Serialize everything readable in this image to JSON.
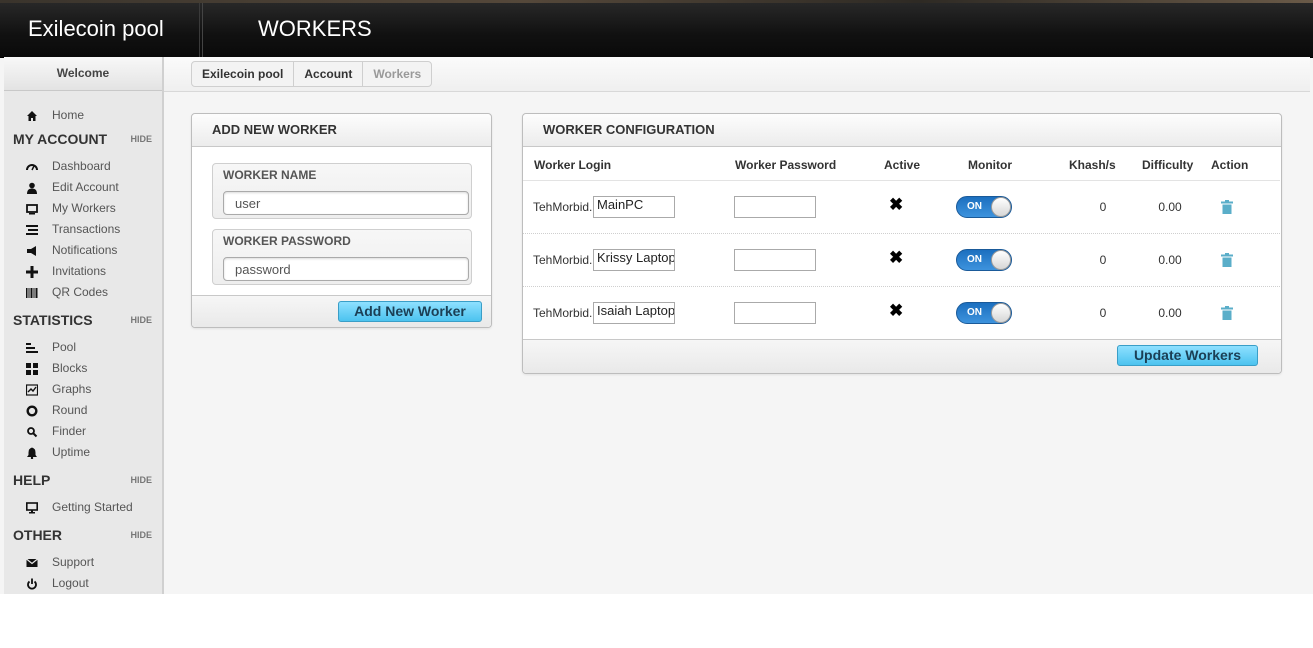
{
  "app": {
    "brand": "Exilecoin pool",
    "page_title": "WORKERS"
  },
  "sidebar": {
    "welcome": "Welcome",
    "home": {
      "label": "Home",
      "icon": "home-icon"
    },
    "sections": [
      {
        "title": "MY ACCOUNT",
        "hide": "HIDE",
        "items": [
          {
            "label": "Dashboard",
            "icon": "dashboard-icon"
          },
          {
            "label": "Edit Account",
            "icon": "user-icon"
          },
          {
            "label": "My Workers",
            "icon": "monitor-icon"
          },
          {
            "label": "Transactions",
            "icon": "list-icon"
          },
          {
            "label": "Notifications",
            "icon": "megaphone-icon"
          },
          {
            "label": "Invitations",
            "icon": "plus-icon"
          },
          {
            "label": "QR Codes",
            "icon": "barcode-icon"
          }
        ]
      },
      {
        "title": "STATISTICS",
        "hide": "HIDE",
        "items": [
          {
            "label": "Pool",
            "icon": "bars-icon"
          },
          {
            "label": "Blocks",
            "icon": "grid-icon"
          },
          {
            "label": "Graphs",
            "icon": "chart-icon"
          },
          {
            "label": "Round",
            "icon": "circle-icon"
          },
          {
            "label": "Finder",
            "icon": "search-icon"
          },
          {
            "label": "Uptime",
            "icon": "bell-icon"
          }
        ]
      },
      {
        "title": "HELP",
        "hide": "HIDE",
        "items": [
          {
            "label": "Getting Started",
            "icon": "desktop-icon"
          }
        ]
      },
      {
        "title": "OTHER",
        "hide": "HIDE",
        "items": [
          {
            "label": "Support",
            "icon": "envelope-icon"
          },
          {
            "label": "Logout",
            "icon": "power-icon"
          }
        ]
      }
    ]
  },
  "breadcrumb": [
    "Exilecoin pool",
    "Account",
    "Workers"
  ],
  "add_worker": {
    "title": "ADD NEW WORKER",
    "name_label": "WORKER NAME",
    "name_placeholder": "user",
    "password_label": "WORKER PASSWORD",
    "password_placeholder": "password",
    "button": "Add New Worker"
  },
  "config": {
    "title": "WORKER CONFIGURATION",
    "headers": {
      "login": "Worker Login",
      "password": "Worker Password",
      "active": "Active",
      "monitor": "Monitor",
      "khash": "Khash/s",
      "difficulty": "Difficulty",
      "action": "Action"
    },
    "rows": [
      {
        "prefix": "TehMorbid.",
        "name": "MainPC",
        "active": "✖",
        "monitor": "ON",
        "khash": "0",
        "difficulty": "0.00"
      },
      {
        "prefix": "TehMorbid.",
        "name": "Krissy Laptop",
        "active": "✖",
        "monitor": "ON",
        "khash": "0",
        "difficulty": "0.00"
      },
      {
        "prefix": "TehMorbid.",
        "name": "Isaiah Laptop",
        "active": "✖",
        "monitor": "ON",
        "khash": "0",
        "difficulty": "0.00"
      }
    ],
    "button": "Update Workers"
  },
  "colors": {
    "accent_button": "#4cc3ef",
    "toggle_on": "#2a7fd0",
    "trash": "#5aaec9"
  }
}
